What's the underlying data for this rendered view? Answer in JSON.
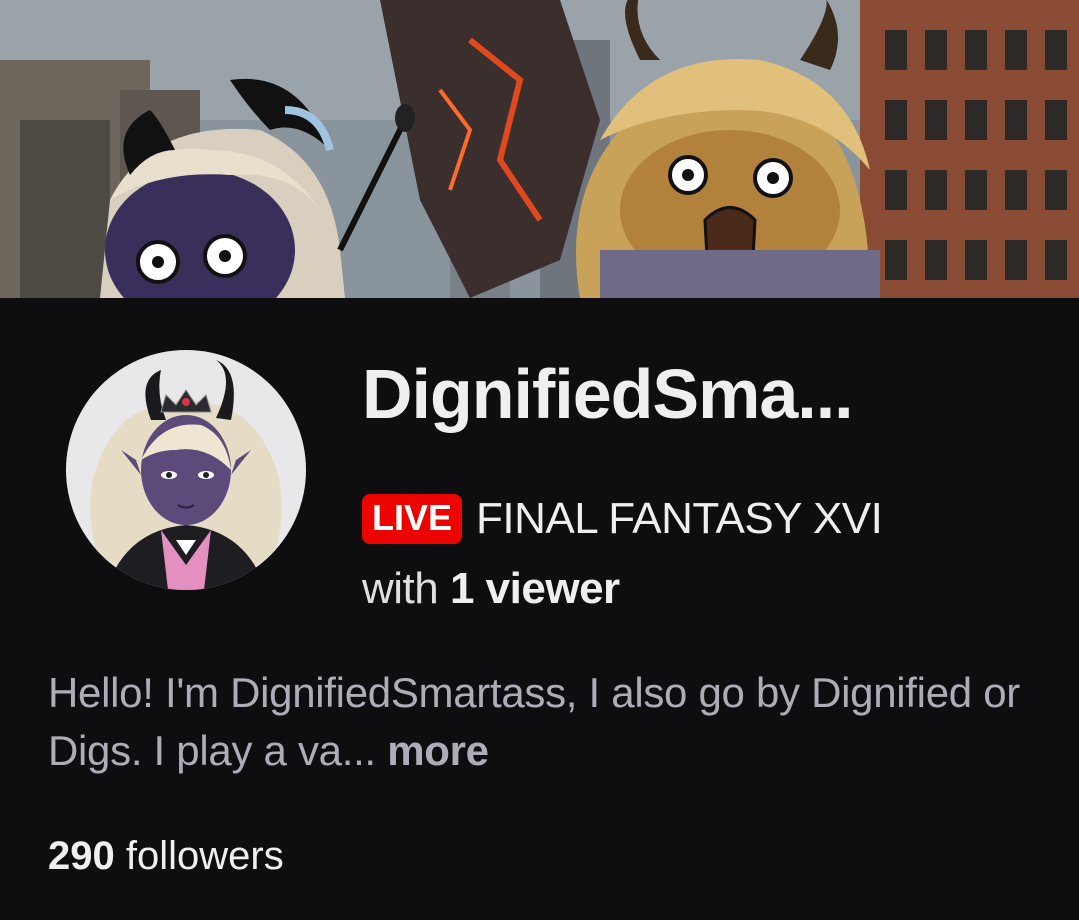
{
  "channel": {
    "name": "DignifiedSma...",
    "live_badge": "LIVE",
    "game": "FINAL FANTASY XVI",
    "viewer_prefix": "with",
    "viewer_count": "1 viewer",
    "bio": "Hello! I'm DignifiedSmartass, I also go by Dignified or Digs. I play a va...",
    "bio_more": "more",
    "followers_count": "290",
    "followers_label": "followers"
  },
  "colors": {
    "background": "#0e0e10",
    "live_red": "#eb0400",
    "text_primary": "#efeff1",
    "text_muted": "#adadb8"
  },
  "icons": {
    "avatar": "channel-avatar",
    "banner": "channel-banner"
  }
}
